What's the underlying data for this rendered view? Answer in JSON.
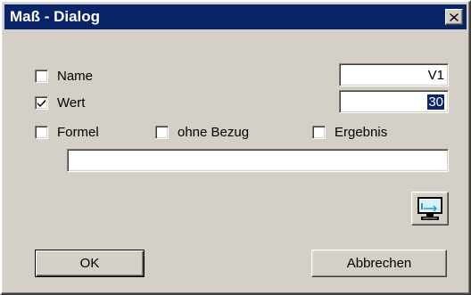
{
  "window": {
    "title": "Maß - Dialog"
  },
  "options": {
    "name": {
      "label": "Name",
      "checked": false,
      "value": "V1"
    },
    "wert": {
      "label": "Wert",
      "checked": true,
      "value": "30"
    },
    "formel": {
      "label": "Formel",
      "checked": false
    },
    "ohne_bezug": {
      "label": "ohne Bezug",
      "checked": false
    },
    "ergebnis": {
      "label": "Ergebnis",
      "checked": false
    }
  },
  "formula_field": {
    "value": ""
  },
  "buttons": {
    "ok": "OK",
    "cancel": "Abbrechen"
  },
  "icons": {
    "close": "close-icon",
    "monitor": "monitor-icon"
  },
  "colors": {
    "titlebar": "#0a246a",
    "dialog_bg": "#d4d0c8",
    "selection": "#0a246a"
  }
}
